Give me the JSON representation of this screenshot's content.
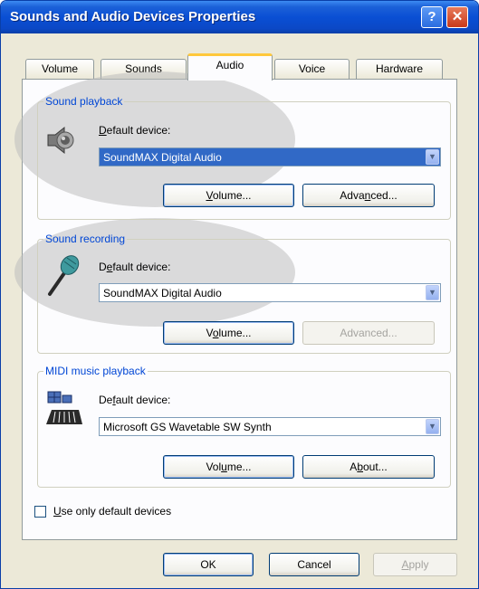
{
  "window": {
    "title": "Sounds and Audio Devices Properties"
  },
  "tabs": [
    {
      "label": "Volume"
    },
    {
      "label": "Sounds"
    },
    {
      "label": "Audio",
      "selected": true
    },
    {
      "label": "Voice"
    },
    {
      "label": "Hardware"
    }
  ],
  "sound_playback": {
    "group_label": "Sound playback",
    "default_device_label": "Default device:",
    "selected_device": "SoundMAX Digital Audio",
    "volume_button": "Volume...",
    "advanced_button": "Advanced...",
    "icon": "speaker-icon"
  },
  "sound_recording": {
    "group_label": "Sound recording",
    "default_device_label": "Default device:",
    "selected_device": "SoundMAX Digital Audio",
    "volume_button": "Volume...",
    "advanced_button": "Advanced...",
    "advanced_enabled": false,
    "icon": "microphone-icon"
  },
  "midi_playback": {
    "group_label": "MIDI music playback",
    "default_device_label": "Default device:",
    "selected_device": "Microsoft GS Wavetable SW Synth",
    "volume_button": "Volume...",
    "about_button": "About...",
    "icon": "midi-keyboard-icon"
  },
  "options": {
    "use_default_devices_label": "Use only default devices",
    "use_default_devices_checked": false
  },
  "footer": {
    "ok": "OK",
    "cancel": "Cancel",
    "apply": "Apply",
    "apply_enabled": false
  },
  "colors": {
    "title_bar": "#0a4fd4",
    "group_label": "#0046d5",
    "selection": "#3169c6",
    "active_tab_accent": "#ffc83c"
  }
}
